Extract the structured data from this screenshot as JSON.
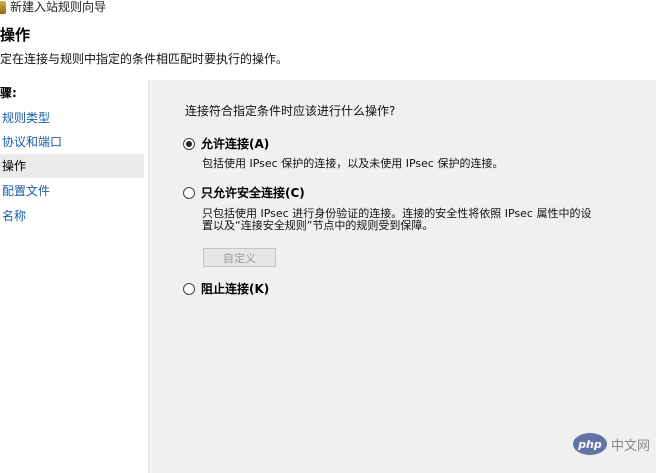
{
  "window": {
    "title": "新建入站规则向导"
  },
  "page": {
    "title": "操作",
    "description": "定在连接与规则中指定的条件相匹配时要执行的操作。"
  },
  "steps": {
    "header": "骤:",
    "items": [
      {
        "label": "规则类型",
        "current": false
      },
      {
        "label": "协议和端口",
        "current": false
      },
      {
        "label": "操作",
        "current": true
      },
      {
        "label": "配置文件",
        "current": false
      },
      {
        "label": "名称",
        "current": false
      }
    ]
  },
  "content": {
    "question": "连接符合指定条件时应该进行什么操作?",
    "options": [
      {
        "label": "允许连接(A)",
        "checked": true,
        "description": "包括使用 IPsec 保护的连接，以及未使用 IPsec 保护的连接。"
      },
      {
        "label": "只允许安全连接(C)",
        "checked": false,
        "description_line1": "只包括使用 IPsec 进行身份验证的连接。连接的安全性将依照 IPsec 属性中的设",
        "description_line2": "置以及“连接安全规则”节点中的规则受到保障。"
      },
      {
        "label": "阻止连接(K)",
        "checked": false
      }
    ],
    "customize_button": "自定义"
  },
  "watermark": {
    "logo": "php",
    "text": "中文网"
  }
}
